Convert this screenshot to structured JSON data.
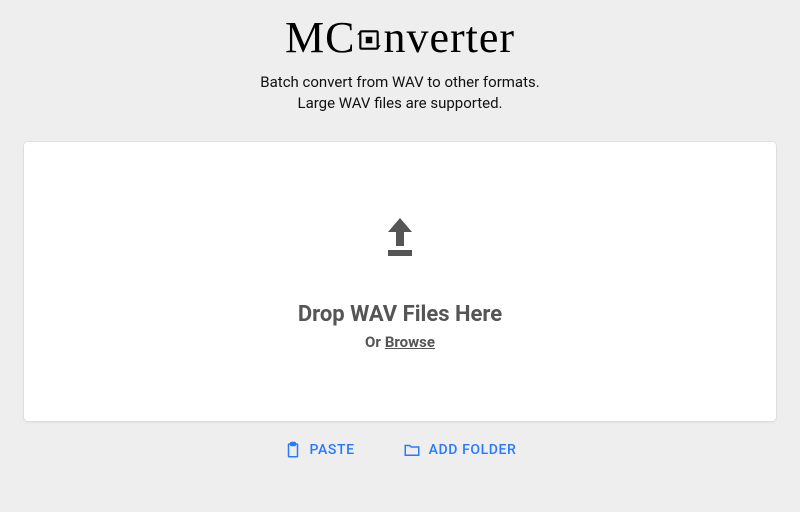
{
  "header": {
    "logo_left": "MC",
    "logo_right": "nverter",
    "subtitle_line1": "Batch convert from WAV to other formats.",
    "subtitle_line2": "Large WAV files are supported."
  },
  "dropzone": {
    "title": "Drop WAV Files Here",
    "or_label": "Or",
    "browse_label": "Browse"
  },
  "actions": {
    "paste": "PASTE",
    "add_folder": "ADD FOLDER"
  }
}
